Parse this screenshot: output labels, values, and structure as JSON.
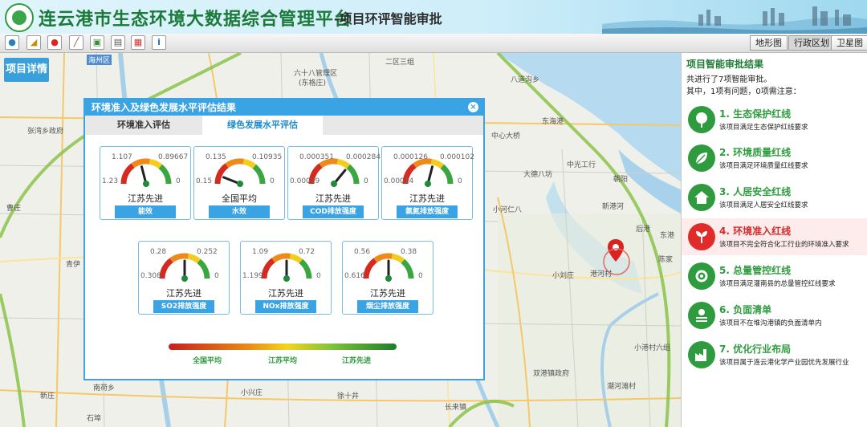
{
  "header": {
    "title": "连云港市生态环境大数据综合管理平台",
    "subtitle": "-项目环评智能审批"
  },
  "toolbar": {
    "tools": [
      "globe-icon",
      "measure-icon",
      "pin-icon",
      "draw-icon",
      "layers-icon",
      "print-icon",
      "grid-icon",
      "info-icon"
    ],
    "map_types": [
      "地形图",
      "行政区划",
      "卫星图"
    ],
    "active_map_type": "行政区划"
  },
  "map": {
    "project_detail_button": "项目详情",
    "labels": [
      "海州区",
      "六十八管理区",
      "(东格庄)",
      "二区三组",
      "八道沟乡",
      "东海港",
      "中心大桥",
      "大德八坊",
      "中光工行",
      "小河仁八",
      "小刘庄",
      "港河村",
      "新港河",
      "朝阳",
      "后港",
      "东港",
      "陈家",
      "小港村六组",
      "双港镇政府",
      "潮河滩村",
      "徐十井",
      "小兴庄",
      "长来镇",
      "新庄",
      "石埠",
      "青伊",
      "南荷乡",
      "张湾乡政府",
      "曹庄"
    ]
  },
  "dialog": {
    "title": "环境准入及绿色发展水平评估结果",
    "tabs": [
      "环境准入评估",
      "绿色发展水平评估"
    ],
    "active_tab": 1,
    "gauges": [
      {
        "left": "1.107",
        "right": "0.89667",
        "min": "1.23",
        "max": "0",
        "value_fraction": 0.42,
        "rating": "江苏先进",
        "name": "能效"
      },
      {
        "left": "0.135",
        "right": "0.10935",
        "min": "0.15",
        "max": "0",
        "value_fraction": 0.12,
        "rating": "全国平均",
        "name": "水效"
      },
      {
        "left": "0.000351",
        "right": "0.000284",
        "min": "0.00039",
        "max": "0",
        "value_fraction": 0.72,
        "rating": "江苏先进",
        "name": "COD排放强度"
      },
      {
        "left": "0.000126",
        "right": "0.000102",
        "min": "0.00014",
        "max": "0",
        "value_fraction": 0.58,
        "rating": "江苏先进",
        "name": "氨氮排放强度"
      },
      {
        "left": "0.28",
        "right": "0.252",
        "min": "0.308",
        "max": "0",
        "value_fraction": 0.5,
        "rating": "江苏先进",
        "name": "SO2排放强度"
      },
      {
        "left": "1.09",
        "right": "0.72",
        "min": "1.199",
        "max": "0",
        "value_fraction": 0.5,
        "rating": "江苏先进",
        "name": "NOx排放强度"
      },
      {
        "left": "0.56",
        "right": "0.38",
        "min": "0.616",
        "max": "0",
        "value_fraction": 0.5,
        "rating": "江苏先进",
        "name": "烟尘排放强度"
      }
    ],
    "scale_labels": [
      "全国平均",
      "江苏平均",
      "江苏先进"
    ]
  },
  "panel": {
    "title": "项目智能审批结果",
    "summary_1": "共进行了7项智能审批。",
    "summary_2": "其中，1项有问题，0项需注意：",
    "items": [
      {
        "title": "1. 生态保护红线",
        "desc": "该项目满足生态保护红线要求",
        "icon": "tree-icon",
        "status": "ok"
      },
      {
        "title": "2. 环境质量红线",
        "desc": "该项目满足环境质量红线要求",
        "icon": "leaf-icon",
        "status": "ok"
      },
      {
        "title": "3. 人居安全红线",
        "desc": "该项目满足人居安全红线要求",
        "icon": "house-icon",
        "status": "ok"
      },
      {
        "title": "4. 环境准入红线",
        "desc": "该项目不完全符合化工行业的环境准入要求",
        "icon": "plant-icon",
        "status": "alert"
      },
      {
        "title": "5. 总量管控红线",
        "desc": "该项目满足灌南县的总量管控红线要求",
        "icon": "gear-icon",
        "status": "ok"
      },
      {
        "title": "6. 负面清单",
        "desc": "该项目不在堆沟港镇的负面清单内",
        "icon": "list-icon",
        "status": "ok"
      },
      {
        "title": "7. 优化行业布局",
        "desc": "该项目属于连云港化学产业园优先发展行业",
        "icon": "factory-icon",
        "status": "ok"
      }
    ]
  },
  "colors": {
    "brand_green": "#2e9b3f",
    "accent_blue": "#3aa3e3",
    "alert_red": "#e02b2b"
  }
}
